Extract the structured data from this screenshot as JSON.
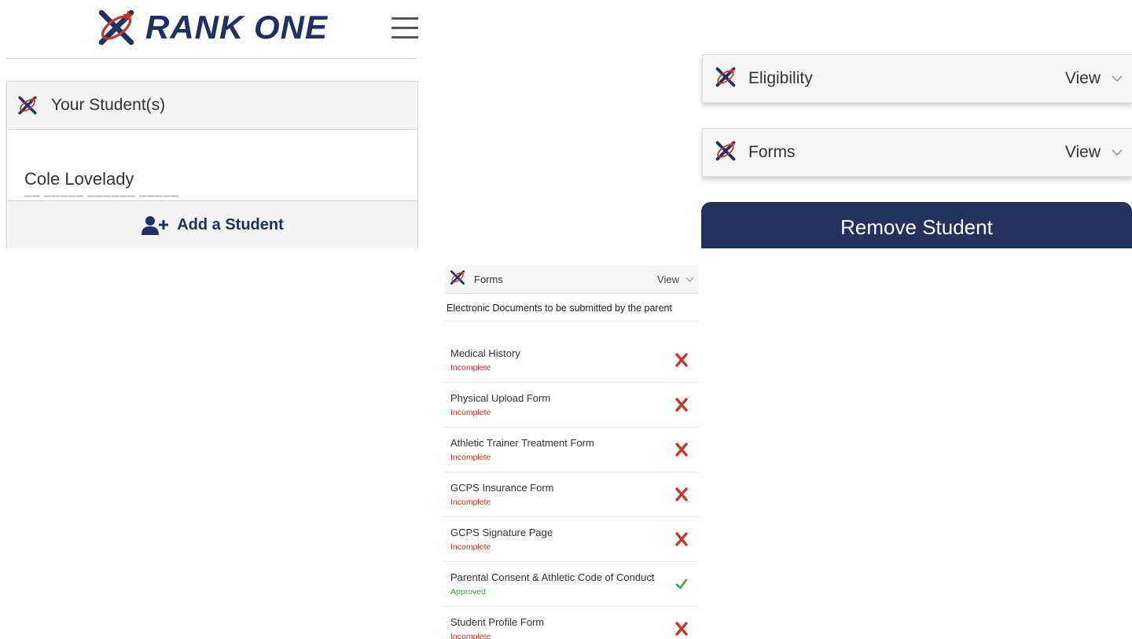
{
  "brand": {
    "name": "RANK ONE",
    "navy": "#1f3164",
    "red": "#c0392b"
  },
  "students_panel": {
    "title": "Your Student(s)",
    "student_name": "Cole Lovelady",
    "add_button_label": "Add a Student"
  },
  "student_detail": {
    "accordions": [
      {
        "title": "Eligibility",
        "action": "View"
      },
      {
        "title": "Forms",
        "action": "View"
      }
    ],
    "remove_label": "Remove Student"
  },
  "forms_panel": {
    "title": "Forms",
    "action": "View",
    "subtitle": "Electronic Documents to be submitted by the parent",
    "items": [
      {
        "name": "Medical History",
        "status": "Incomplete",
        "state": "incomplete"
      },
      {
        "name": "Physical Upload Form",
        "status": "Incomplete",
        "state": "incomplete"
      },
      {
        "name": "Athletic Trainer Treatment Form",
        "status": "Incomplete",
        "state": "incomplete"
      },
      {
        "name": "GCPS Insurance Form",
        "status": "Incomplete",
        "state": "incomplete"
      },
      {
        "name": "GCPS Signature Page",
        "status": "Incomplete",
        "state": "incomplete"
      },
      {
        "name": "Parental Consent & Athletic Code of Conduct",
        "status": "Approved",
        "state": "approved"
      },
      {
        "name": "Student Profile Form",
        "status": "Incomplete",
        "state": "incomplete"
      }
    ]
  },
  "icons": {
    "brand": "rank-one-logo-icon",
    "menu": "hamburger-menu-icon",
    "add_user": "add-user-icon",
    "chevron": "chevron-down-icon",
    "incomplete": "x-mark-icon",
    "approved": "check-mark-icon"
  }
}
